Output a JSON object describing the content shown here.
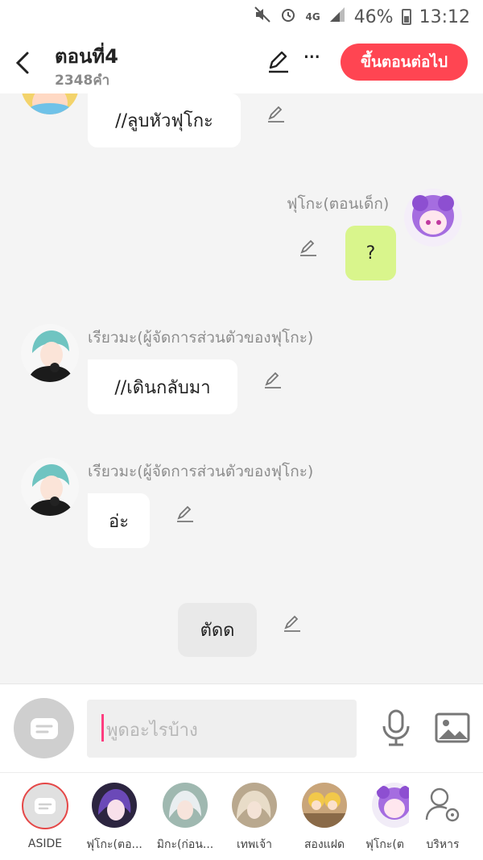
{
  "status_bar": {
    "network": "4G",
    "battery": "46%",
    "time": "13:12"
  },
  "header": {
    "title": "ตอนที่4",
    "subtitle": "2348คำ",
    "more": "···",
    "next_button": "ขึ้นตอนต่อไป"
  },
  "messages": [
    {
      "text": "//ลูบหัวฟุโกะ"
    },
    {
      "name": "ฟุโกะ(ตอนเด็ก)",
      "text": "?"
    },
    {
      "name": "เรียวมะ(ผู้จัดการส่วนตัวของฟุโกะ)",
      "text": "//เดินกลับมา"
    },
    {
      "name": "เรียวมะ(ผู้จัดการส่วนตัวของฟุโกะ)",
      "text": "อ่ะ"
    },
    {
      "text": "ตัดด"
    }
  ],
  "input": {
    "placeholder": "พูดอะไรบ้าง"
  },
  "characters": [
    {
      "label": "ASIDE"
    },
    {
      "label": "ฟุโกะ(ตอ..."
    },
    {
      "label": "มิกะ(ก่อน..."
    },
    {
      "label": "เทพเจ้า"
    },
    {
      "label": "สองแฝด"
    },
    {
      "label": "ฟุโกะ(ต"
    },
    {
      "label": "บริหาร"
    }
  ],
  "colors": {
    "accent": "#ff4552",
    "self_bubble": "#d9f58c",
    "caret": "#ff3d7f"
  }
}
